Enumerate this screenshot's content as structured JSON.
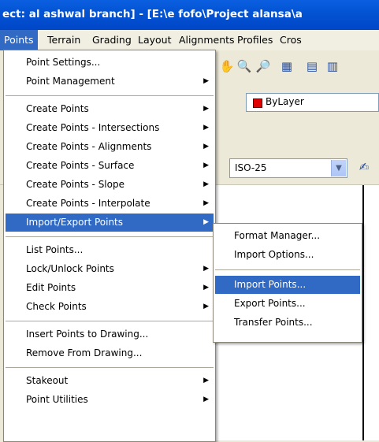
{
  "window": {
    "title": "ect: al ashwal branch] - [E:\\e fofo\\Project alansa\\a"
  },
  "menubar": [
    {
      "label": "Points",
      "active": true
    },
    {
      "label": "Terrain"
    },
    {
      "label": "Grading"
    },
    {
      "label": "Layout"
    },
    {
      "label": "Alignments"
    },
    {
      "label": "Profiles"
    },
    {
      "label": "Cros"
    }
  ],
  "toolbar": {
    "layer_value": "ByLayer",
    "layer_color": "#e00000",
    "dimstyle_value": "ISO-25"
  },
  "points_menu": {
    "items": [
      {
        "label": "Point Settings...",
        "submenu": false
      },
      {
        "label": "Point Management",
        "submenu": true
      },
      {
        "label": "Create Points",
        "submenu": true
      },
      {
        "label": "Create Points - Intersections",
        "submenu": true
      },
      {
        "label": "Create Points - Alignments",
        "submenu": true
      },
      {
        "label": "Create Points - Surface",
        "submenu": true
      },
      {
        "label": "Create Points - Slope",
        "submenu": true
      },
      {
        "label": "Create Points - Interpolate",
        "submenu": true
      },
      {
        "label": "Import/Export Points",
        "submenu": true,
        "highlighted": true
      },
      {
        "label": "List Points...",
        "submenu": false
      },
      {
        "label": "Lock/Unlock Points",
        "submenu": true
      },
      {
        "label": "Edit Points",
        "submenu": true
      },
      {
        "label": "Check Points",
        "submenu": true
      },
      {
        "label": "Insert Points to Drawing...",
        "submenu": false
      },
      {
        "label": "Remove From Drawing...",
        "submenu": false
      },
      {
        "label": "Stakeout",
        "submenu": true
      },
      {
        "label": "Point Utilities",
        "submenu": true
      }
    ]
  },
  "import_export_submenu": {
    "items": [
      {
        "label": "Format Manager..."
      },
      {
        "label": "Import Options..."
      },
      {
        "label": "Import Points...",
        "highlighted": true
      },
      {
        "label": "Export Points..."
      },
      {
        "label": "Transfer Points..."
      }
    ]
  }
}
